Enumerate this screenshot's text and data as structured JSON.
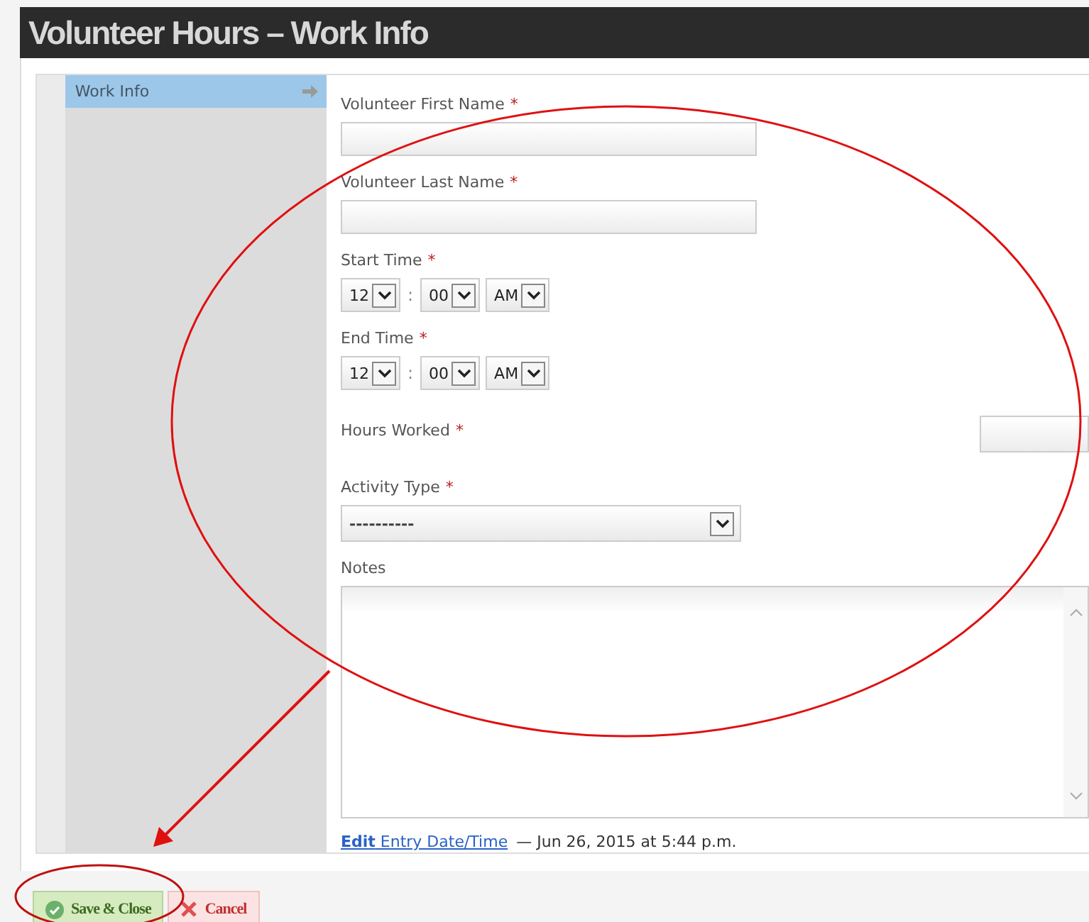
{
  "window": {
    "title": "Volunteer Hours – Work Info"
  },
  "sidebar": {
    "items": [
      {
        "label": "Work Info",
        "selected": true
      }
    ]
  },
  "fields": [
    {
      "kind": "text",
      "label": "Volunteer First Name",
      "required_mark": "*"
    },
    {
      "kind": "text",
      "label": "Volunteer Last Name",
      "required_mark": "*"
    },
    {
      "kind": "time",
      "label": "Start Time",
      "required_mark": "*",
      "hour": "12",
      "minute": "00",
      "period": "AM",
      "separator": ":"
    },
    {
      "kind": "time",
      "label": "End Time",
      "required_mark": "*",
      "hour": "12",
      "minute": "00",
      "period": "AM",
      "separator": ":"
    },
    {
      "kind": "inline",
      "label": "Hours Worked",
      "required_mark": "*"
    },
    {
      "kind": "select",
      "label": "Activity Type",
      "required_mark": "*",
      "value": "----------"
    },
    {
      "kind": "textarea",
      "label": "Notes"
    }
  ],
  "entry": {
    "link_bold": "Edit",
    "link": "Entry Date/Time",
    "dash": "—",
    "date": "Jun 26, 2015 at 5:44 p.m."
  },
  "buttons": [
    {
      "kind": "save",
      "label": "Save & Close"
    },
    {
      "kind": "cancel",
      "label": "Cancel"
    }
  ]
}
